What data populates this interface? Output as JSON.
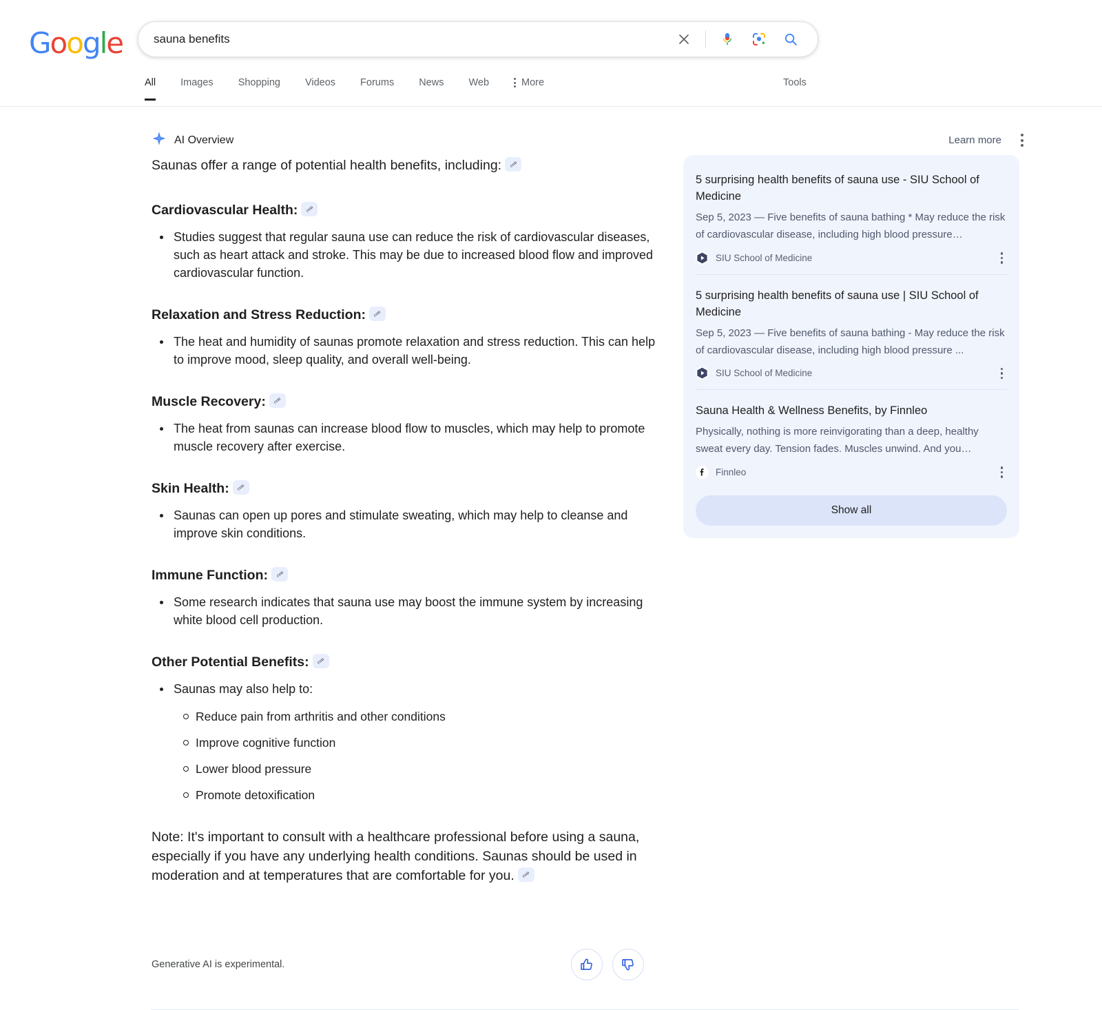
{
  "brand": {
    "logo_letters": [
      "G",
      "o",
      "o",
      "g",
      "l",
      "e"
    ]
  },
  "search": {
    "value": "sauna benefits",
    "placeholder": "Search",
    "clear_icon": "close-icon",
    "voice_icon": "microphone-icon",
    "lens_icon": "google-lens-icon",
    "submit_icon": "search-icon"
  },
  "tabs": [
    {
      "label": "All",
      "active": true
    },
    {
      "label": "Images",
      "active": false
    },
    {
      "label": "Shopping",
      "active": false
    },
    {
      "label": "Videos",
      "active": false
    },
    {
      "label": "Forums",
      "active": false
    },
    {
      "label": "News",
      "active": false
    },
    {
      "label": "Web",
      "active": false
    }
  ],
  "more_label": "More",
  "tools_label": "Tools",
  "ai_overview": {
    "title": "AI Overview",
    "sparkle_icon": "ai-sparkle-icon",
    "learn_more": "Learn more",
    "lead": "Saunas offer a range of potential health benefits, including:",
    "sections": [
      {
        "heading": "Cardiovascular Health:",
        "bullets": [
          "Studies suggest that regular sauna use can reduce the risk of cardiovascular diseases, such as heart attack and stroke. This may be due to increased blood flow and improved cardiovascular function."
        ]
      },
      {
        "heading": "Relaxation and Stress Reduction:",
        "bullets": [
          "The heat and humidity of saunas promote relaxation and stress reduction. This can help to improve mood, sleep quality, and overall well-being."
        ]
      },
      {
        "heading": "Muscle Recovery:",
        "bullets": [
          "The heat from saunas can increase blood flow to muscles, which may help to promote muscle recovery after exercise."
        ]
      },
      {
        "heading": "Skin Health:",
        "bullets": [
          "Saunas can open up pores and stimulate sweating, which may help to cleanse and improve skin conditions."
        ]
      },
      {
        "heading": "Immune Function:",
        "bullets": [
          "Some research indicates that sauna use may boost the immune system by increasing white blood cell production."
        ]
      }
    ],
    "other_benefits": {
      "heading": "Other Potential Benefits:",
      "intro": "Saunas may also help to:",
      "items": [
        "Reduce pain from arthritis and other conditions",
        "Improve cognitive function",
        "Lower blood pressure",
        "Promote detoxification"
      ]
    },
    "note": "Note: It's important to consult with a healthcare professional before using a sauna, especially if you have any underlying health conditions. Saunas should be used in moderation and at temperatures that are comfortable for you.",
    "disclaimer": "Generative AI is experimental.",
    "thumbs_up_icon": "thumbs-up-icon",
    "thumbs_down_icon": "thumbs-down-icon",
    "link_chip_icon": "link-icon",
    "kebab_icon": "more-options-icon"
  },
  "sources_panel": {
    "cards": [
      {
        "title": "5 surprising health benefits of sauna use - SIU School of Medicine",
        "snippet": "Sep 5, 2023 — Five benefits of sauna bathing * May reduce the risk of cardiovascular disease, including high blood pressure…",
        "source": "SIU School of Medicine",
        "favicon": "siu-hexagon-icon"
      },
      {
        "title": "5 surprising health benefits of sauna use | SIU School of Medicine",
        "snippet": "Sep 5, 2023 — Five benefits of sauna bathing - May reduce the risk of cardiovascular disease, including high blood pressure ...",
        "source": "SIU School of Medicine",
        "favicon": "siu-hexagon-icon"
      },
      {
        "title": "Sauna Health & Wellness Benefits, by Finnleo",
        "snippet": "Physically, nothing is more reinvigorating than a deep, healthy sweat every day. Tension fades. Muscles unwind. And you…",
        "source": "Finnleo",
        "favicon": "facebook-icon"
      }
    ],
    "show_all_label": "Show all"
  },
  "colors": {
    "accent_blue": "#4285F4",
    "panel_bg": "#f0f4fd",
    "chip_bg": "#e8eefc",
    "show_all_bg": "#dbe4f9"
  }
}
